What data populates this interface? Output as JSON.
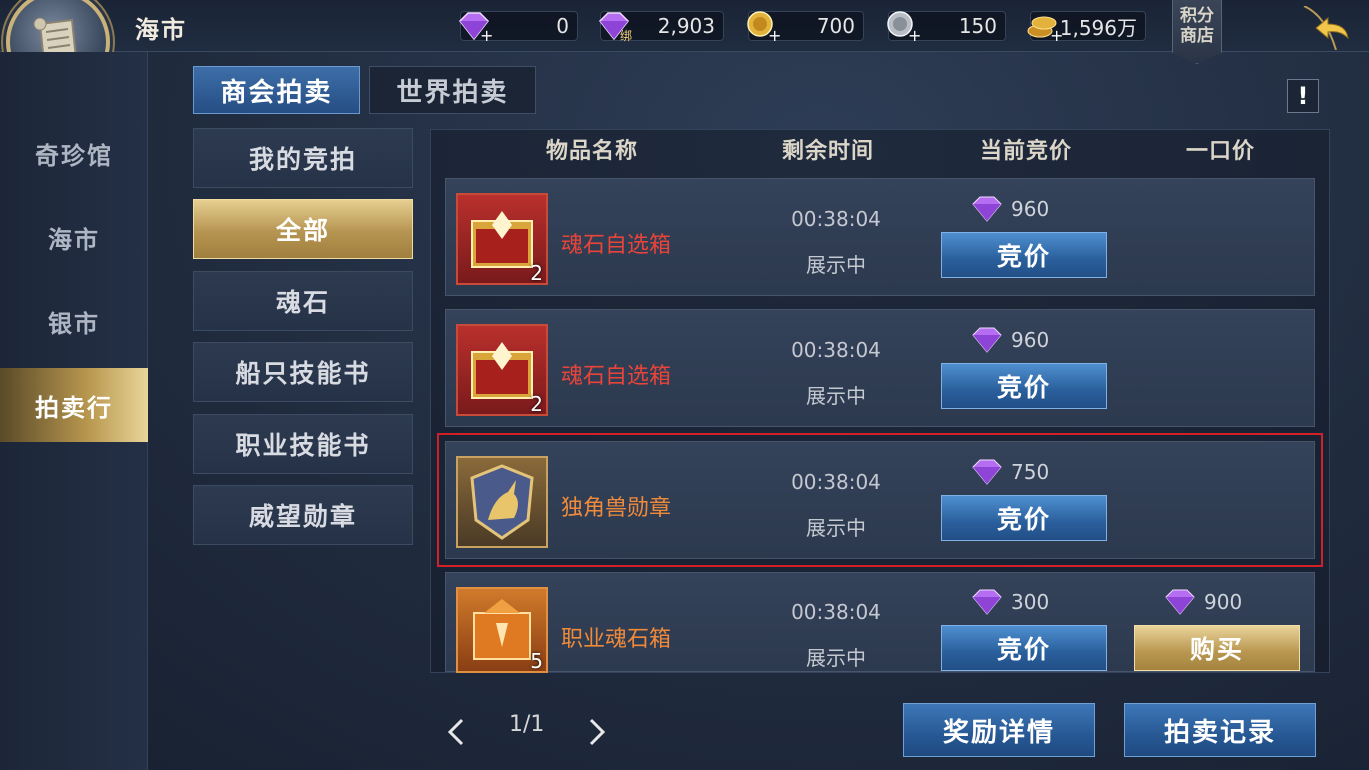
{
  "header": {
    "title": "海市",
    "currencies": [
      {
        "name": "diamond",
        "value": "0"
      },
      {
        "name": "bound-diamond",
        "value": "2,903",
        "badge": "绑"
      },
      {
        "name": "gold-coin",
        "value": "700"
      },
      {
        "name": "silver-coin",
        "value": "150"
      },
      {
        "name": "gold-pile",
        "value": "1,596万"
      }
    ],
    "points_shop": "积分\n商店",
    "points_shop_line1": "积分",
    "points_shop_line2": "商店"
  },
  "leftnav": {
    "items": [
      {
        "label": "奇珍馆"
      },
      {
        "label": "海市"
      },
      {
        "label": "银市"
      },
      {
        "label": "拍卖行"
      }
    ]
  },
  "tabs": [
    {
      "label": "商会拍卖"
    },
    {
      "label": "世界拍卖"
    }
  ],
  "info_button": "!",
  "categories": [
    {
      "label": "我的竞拍"
    },
    {
      "label": "全部"
    },
    {
      "label": "魂石"
    },
    {
      "label": "船只技能书"
    },
    {
      "label": "职业技能书"
    },
    {
      "label": "威望勋章"
    }
  ],
  "table": {
    "headers": [
      "物品名称",
      "剩余时间",
      "当前竞价",
      "一口价"
    ],
    "rows": [
      {
        "name": "魂石自选箱",
        "qty": "2",
        "time": "00:38:04",
        "status": "展示中",
        "bid_price": "960",
        "bid_label": "竞价",
        "name_color": "#e8443a"
      },
      {
        "name": "魂石自选箱",
        "qty": "2",
        "time": "00:38:04",
        "status": "展示中",
        "bid_price": "960",
        "bid_label": "竞价",
        "name_color": "#e8443a"
      },
      {
        "name": "独角兽勋章",
        "qty": "",
        "time": "00:38:04",
        "status": "展示中",
        "bid_price": "750",
        "bid_label": "竞价",
        "name_color": "#f08a3a"
      },
      {
        "name": "职业魂石箱",
        "qty": "5",
        "time": "00:38:04",
        "status": "展示中",
        "bid_price": "300",
        "bid_label": "竞价",
        "buy_price": "900",
        "buy_label": "购买",
        "name_color": "#f08a3a"
      }
    ]
  },
  "footer": {
    "page": "1/1",
    "reward_details": "奖励详情",
    "auction_records": "拍卖记录"
  },
  "colors": {
    "accent_blue": "#2a5f9c",
    "accent_gold": "#b8964f",
    "highlight_red": "#d31f2a"
  }
}
